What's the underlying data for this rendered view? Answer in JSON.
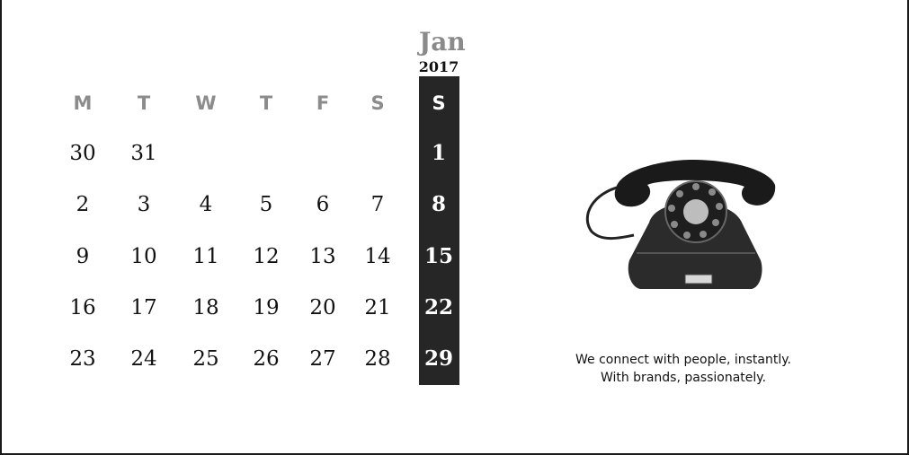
{
  "calendar": {
    "month": "Jan",
    "year": "2017",
    "weekdays": [
      "M",
      "T",
      "W",
      "T",
      "F",
      "S",
      "S"
    ],
    "weeks": [
      [
        "30",
        "31",
        "",
        "",
        "",
        "",
        "1"
      ],
      [
        "2",
        "3",
        "4",
        "5",
        "6",
        "7",
        "8"
      ],
      [
        "9",
        "10",
        "11",
        "12",
        "13",
        "14",
        "15"
      ],
      [
        "16",
        "17",
        "18",
        "19",
        "20",
        "21",
        "22"
      ],
      [
        "23",
        "24",
        "25",
        "26",
        "27",
        "28",
        "29"
      ]
    ]
  },
  "tagline": {
    "line1": "We connect with people, instantly.",
    "line2": "With brands, passionately."
  },
  "image": {
    "subject": "telephone-illustration"
  },
  "colors": {
    "sunday_bar": "#262626",
    "header_gray": "#8c8c8c",
    "month_gray": "#8a8a8a"
  }
}
